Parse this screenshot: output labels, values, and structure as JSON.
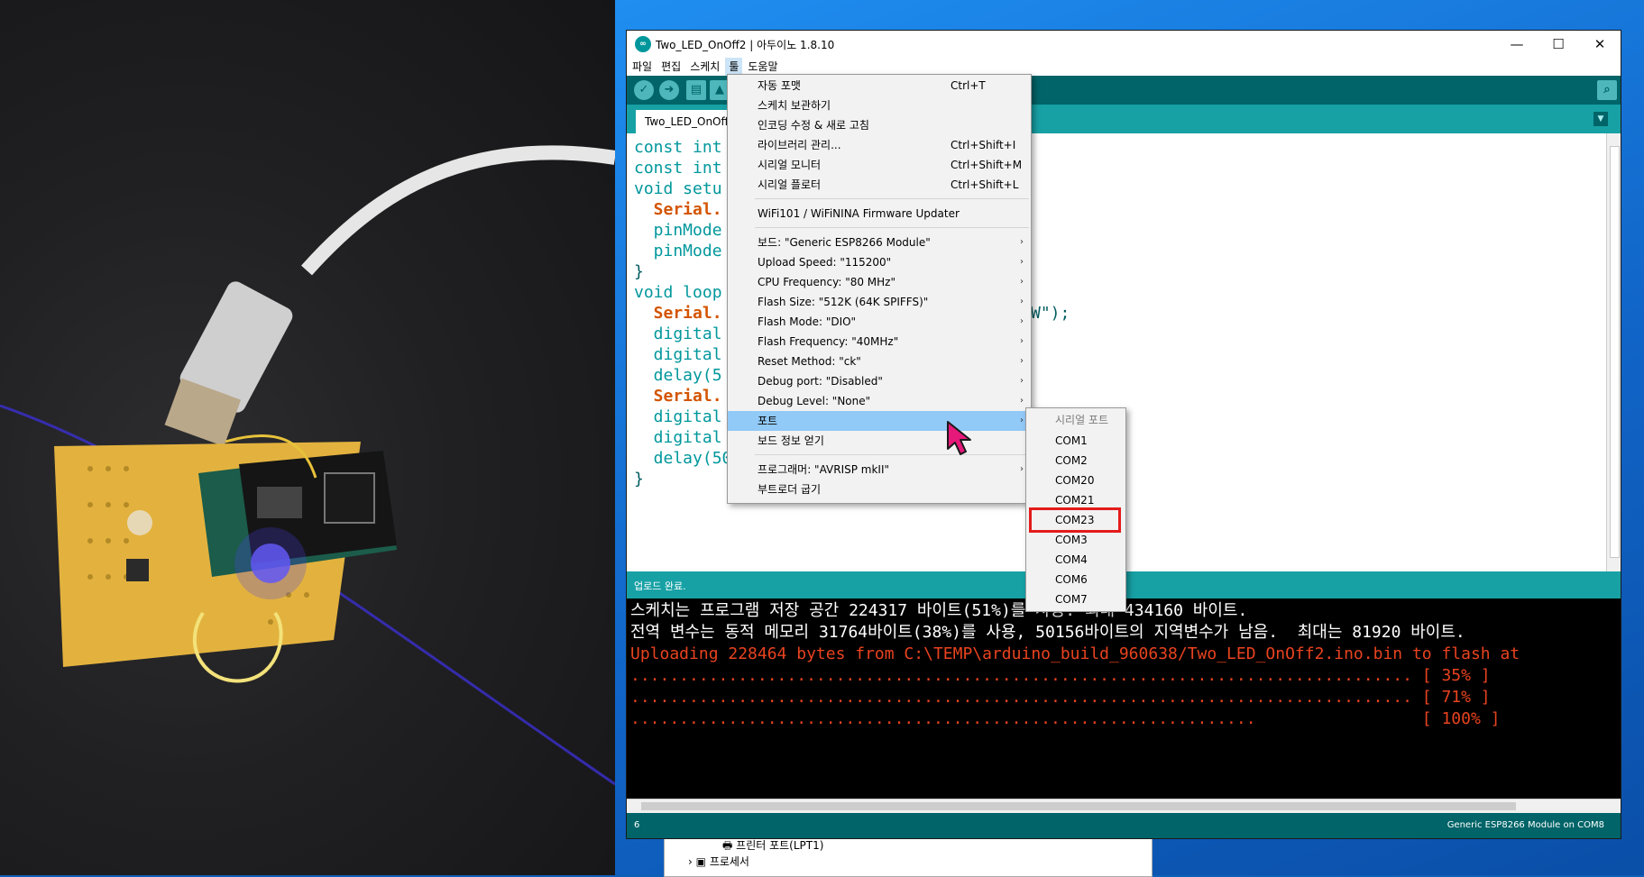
{
  "window": {
    "title": "Two_LED_OnOff2 | 아두이노 1.8.10",
    "icon": "arduino-logo-icon"
  },
  "menubar": [
    "파일",
    "편집",
    "스케치",
    "툴",
    "도움말"
  ],
  "tab": {
    "label": "Two_LED_OnOff2"
  },
  "code": {
    "lines": [
      "const int",
      "const int",
      "void setu",
      "  Serial.",
      "  pinMode",
      "  pinMode",
      "}",
      "void loop",
      "  Serial.",
      "  digital",
      "  digital",
      "  delay(5",
      "  Serial.",
      "  digital",
      "  digital",
      "  delay(500);",
      "}"
    ],
    "partial_tail": "W\");"
  },
  "tools_menu": {
    "items": [
      {
        "label": "자동 포맷",
        "shortcut": "Ctrl+T"
      },
      {
        "label": "스케치 보관하기",
        "shortcut": ""
      },
      {
        "label": "인코딩 수정 & 새로 고침",
        "shortcut": ""
      },
      {
        "label": "라이브러리 관리...",
        "shortcut": "Ctrl+Shift+I"
      },
      {
        "label": "시리얼 모니터",
        "shortcut": "Ctrl+Shift+M"
      },
      {
        "label": "시리얼 플로터",
        "shortcut": "Ctrl+Shift+L"
      },
      {
        "label": "WiFi101 / WiFiNINA Firmware Updater",
        "shortcut": ""
      },
      {
        "label": "보드: \"Generic ESP8266 Module\"",
        "submenu": true
      },
      {
        "label": "Upload Speed: \"115200\"",
        "submenu": true
      },
      {
        "label": "CPU Frequency: \"80 MHz\"",
        "submenu": true
      },
      {
        "label": "Flash Size: \"512K (64K SPIFFS)\"",
        "submenu": true
      },
      {
        "label": "Flash Mode: \"DIO\"",
        "submenu": true
      },
      {
        "label": "Flash Frequency: \"40MHz\"",
        "submenu": true
      },
      {
        "label": "Reset Method: \"ck\"",
        "submenu": true
      },
      {
        "label": "Debug port: \"Disabled\"",
        "submenu": true
      },
      {
        "label": "Debug Level: \"None\"",
        "submenu": true
      },
      {
        "label": "포트",
        "submenu": true,
        "highlighted": true
      },
      {
        "label": "보드 정보 얻기"
      },
      {
        "label": "프로그래머: \"AVRISP mkII\"",
        "submenu": true
      },
      {
        "label": "부트로더 굽기"
      }
    ]
  },
  "port_submenu": {
    "header": "시리얼 포트",
    "ports": [
      "COM1",
      "COM2",
      "COM20",
      "COM21",
      "COM23",
      "COM3",
      "COM4",
      "COM6",
      "COM7"
    ],
    "selected": "COM23"
  },
  "status_message": "업로드 완료.",
  "console": {
    "lines": [
      "스케치는 프로그램 저장 공간 224317 바이트(51%)를 사용. 최대 434160 바이트.",
      "전역 변수는 동적 메모리 31764바이트(38%)를 사용, 50156바이트의 지역변수가 남음.  최대는 81920 바이트.",
      "Uploading 228464 bytes from C:\\TEMP\\arduino_build_960638/Two_LED_OnOff2.ino.bin to flash at",
      "................................................................................ [ 35% ]",
      "................................................................................ [ 71% ]",
      "................................................................                 [ 100% ]"
    ]
  },
  "footer": {
    "line": "6",
    "board": "Generic ESP8266 Module on COM8"
  },
  "device_manager": {
    "items": [
      "프린터 포트(LPT1)",
      "프로세서"
    ]
  },
  "colors": {
    "arduino_teal": "#006468",
    "teal_light": "#17a1a5",
    "console_orange": "#e8431f",
    "highlight": "#91c9f7",
    "callout_red": "#e41b1b"
  }
}
